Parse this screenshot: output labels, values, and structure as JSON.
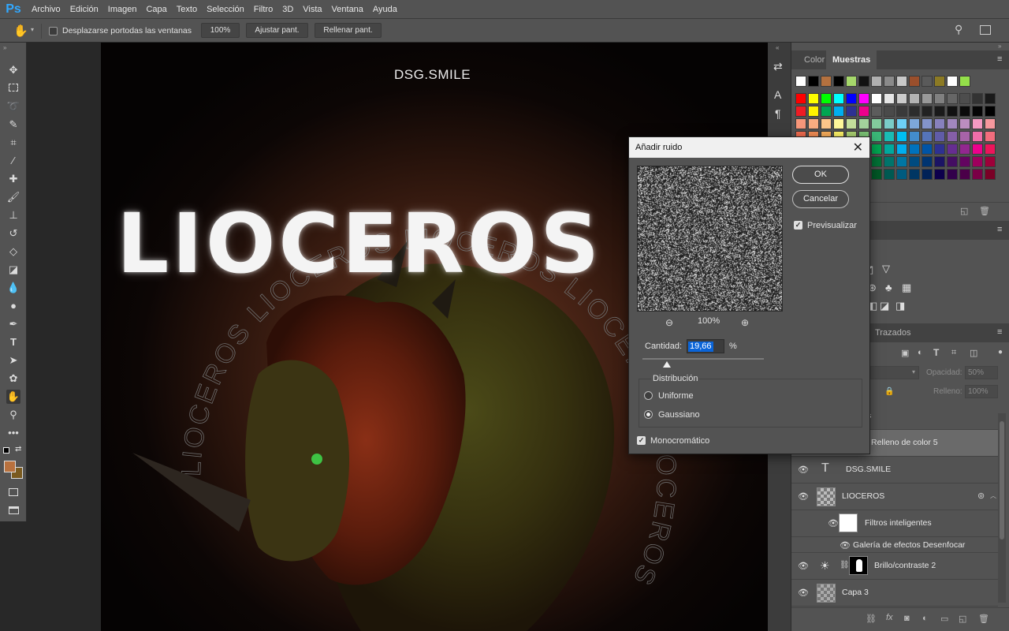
{
  "app": {
    "logo": "Ps"
  },
  "menu": [
    "Archivo",
    "Edición",
    "Imagen",
    "Capa",
    "Texto",
    "Selección",
    "Filtro",
    "3D",
    "Vista",
    "Ventana",
    "Ayuda"
  ],
  "options": {
    "scroll_all_label": "Desplazarse portodas las ventanas",
    "zoom_btn": "100%",
    "fit_btn": "Ajustar pant.",
    "fill_btn": "Rellenar pant."
  },
  "canvas": {
    "big_title": "LIOCEROS",
    "small_title": "DSG.SMILE",
    "ring_text": "LIOCEROS LIOCEROS LIOCEROS LIOCEROS LIOCEROS"
  },
  "swatches_panel": {
    "tabs": [
      "Color",
      "Muestras"
    ],
    "active_tab": "Muestras"
  },
  "swatch_colors": {
    "row0": [
      "#ffffff",
      "#000000",
      "#b4713f",
      "#000000",
      "#a6d86b",
      "#111111",
      "#b0b0b0",
      "#8a8a8a",
      "#c8c8c8",
      "#9a4f2c",
      "#5a5a5a",
      "#8c7a24",
      "#ffffff",
      "#94e04a"
    ],
    "row1": [
      "#ff0000",
      "#ffff00",
      "#00ff00",
      "#00ffff",
      "#0000ff",
      "#ff00ff",
      "#ffffff",
      "#e6e6e6",
      "#cccccc",
      "#b3b3b3",
      "#999999",
      "#808080",
      "#666666",
      "#4d4d4d",
      "#333333",
      "#1a1a1a"
    ],
    "row2": [
      "#ee1c24",
      "#fff200",
      "#00a651",
      "#00aeef",
      "#2e3192",
      "#ec008c",
      "#5c5c5c",
      "#4a4a4a",
      "#3a3a3a",
      "#2c2c2c",
      "#222222",
      "#1a1a1a",
      "#111111",
      "#0a0a0a",
      "#050505",
      "#000000"
    ],
    "row3": [
      "#f7977a",
      "#f9ad81",
      "#fdc68a",
      "#fff79a",
      "#c4df9b",
      "#a3d39c",
      "#82ca9c",
      "#7accc8",
      "#6dcff6",
      "#7da7d9",
      "#8393ca",
      "#8781bd",
      "#a187be",
      "#bc8dbf",
      "#f49ac2",
      "#f6989d"
    ],
    "row4": [
      "#f26c4f",
      "#f68e55",
      "#fbaf5c",
      "#fff467",
      "#acd372",
      "#7cc576",
      "#3bb878",
      "#1abbb4",
      "#00bff3",
      "#438ccb",
      "#5574b9",
      "#605ca8",
      "#855fa8",
      "#a763a8",
      "#f06ea9",
      "#f26d7d"
    ],
    "row5": [
      "#ed1c24",
      "#f26522",
      "#f7941d",
      "#fff200",
      "#8dc63f",
      "#39b54a",
      "#00a651",
      "#00a99d",
      "#00aeef",
      "#0072bc",
      "#0054a6",
      "#2e3192",
      "#662d91",
      "#92278f",
      "#ec008c",
      "#ed145b"
    ],
    "row6": [
      "#9e0b0f",
      "#a0410d",
      "#a36209",
      "#aba000",
      "#598527",
      "#1a7b30",
      "#007236",
      "#00746b",
      "#0076a3",
      "#004b80",
      "#003471",
      "#1b1464",
      "#440e62",
      "#630460",
      "#9e005d",
      "#9e0039"
    ],
    "row7": [
      "#790000",
      "#7b2e00",
      "#7d4900",
      "#827b00",
      "#406618",
      "#005e20",
      "#005826",
      "#005952",
      "#005b7f",
      "#003663",
      "#002157",
      "#0d004c",
      "#32004b",
      "#4b0049",
      "#7b0046",
      "#7a0026"
    ],
    "row8": [
      "#c69c6d",
      "#a67c52",
      "#8c6239",
      "#754c24",
      "#603913"
    ]
  },
  "paths_panel": {
    "tab": "Trazados",
    "opacity_label": "Opacidad:",
    "opacity_value": "50%",
    "fill_label": "Relleno:",
    "fill_value": "100%"
  },
  "layers": {
    "fill_layer": "Relleno de color 5",
    "dsg_layer": "DSG.SMILE",
    "lioceros_layer": "LIOCEROS",
    "smart_filters": "Filtros inteligentes",
    "blur_gallery": "Galería de efectos Desenfocar",
    "brightness_layer": "Brillo/contraste 2",
    "layer3": "Capa 3",
    "partial_row": "s"
  },
  "dialog": {
    "title": "Añadir ruido",
    "ok": "OK",
    "cancel": "Cancelar",
    "preview_label": "Previsualizar",
    "zoom": "100%",
    "amount_label": "Cantidad:",
    "amount_value": "19,66",
    "amount_unit": "%",
    "amount_slider_fraction": 0.2,
    "distribution_title": "Distribución",
    "uniform": "Uniforme",
    "gaussian": "Gaussiano",
    "mono": "Monocromático"
  },
  "colors": {
    "foreground": "#b8713e",
    "background": "#7a5a1f",
    "ps_blue": "#31a8ff",
    "selection_blue": "#0a64d8"
  }
}
